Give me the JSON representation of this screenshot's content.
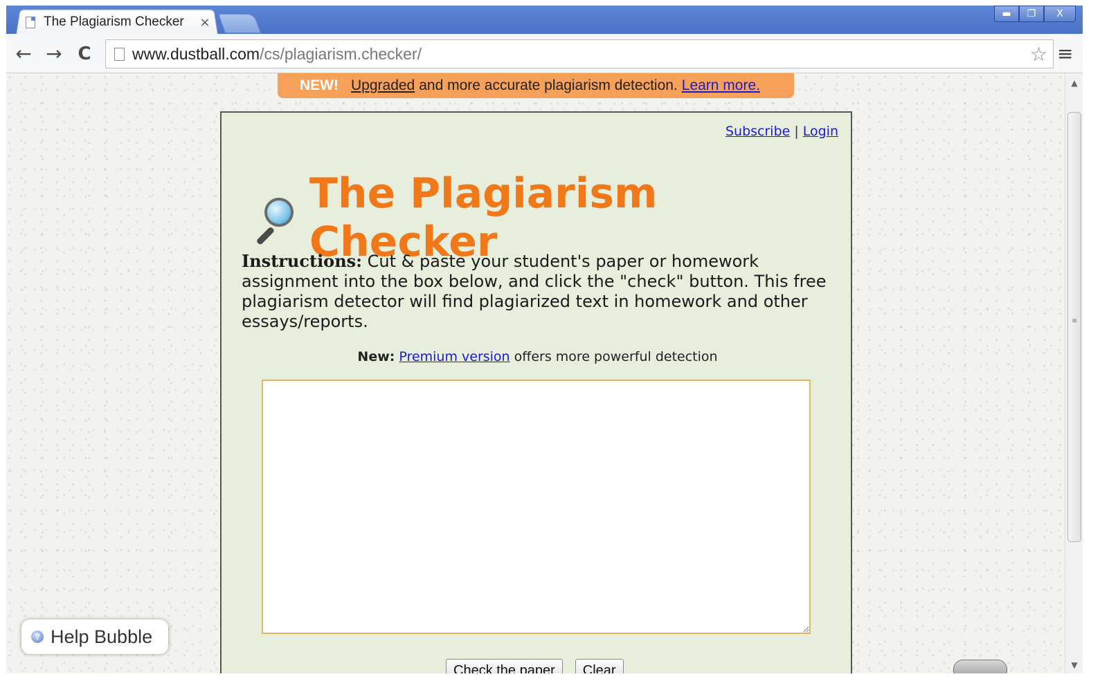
{
  "browser": {
    "tab_title": "The Plagiarism Checker",
    "tab_close": "×",
    "url_domain": "www.dustball.com",
    "url_path": "/cs/plagiarism.checker/",
    "back_glyph": "←",
    "forward_glyph": "→",
    "reload_glyph": "C",
    "star_glyph": "☆",
    "menu_glyph": "≡",
    "win_min": "▬",
    "win_max": "❐",
    "win_close": "X"
  },
  "banner": {
    "new": "NEW!",
    "upgraded": "Upgraded",
    "middle": "and more accurate plagiarism detection.",
    "learn_more": "Learn more."
  },
  "account": {
    "subscribe": "Subscribe",
    "separator": "|",
    "login": "Login"
  },
  "header": {
    "title": "The Plagiarism Checker"
  },
  "instructions": {
    "label": "Instructions:",
    "text": " Cut & paste your student's paper or homework assignment into the box below, and click the \"check\" button. This free plagiarism detector will find plagiarized text in homework and other essays/reports."
  },
  "premium": {
    "label": "New:",
    "link": "Premium version",
    "text": " offers more powerful detection"
  },
  "form": {
    "paper_value": "",
    "check_button": "Check the paper",
    "clear_button": "Clear"
  },
  "help": {
    "label": "Help Bubble",
    "icon": "?"
  },
  "scroll": {
    "up": "▲",
    "down": "▼",
    "grip": "≡"
  },
  "colors": {
    "title_orange": "#f07819",
    "banner_orange": "#f6a05a",
    "panel_green": "#e7eedb",
    "link_blue": "#1a1ad6"
  }
}
